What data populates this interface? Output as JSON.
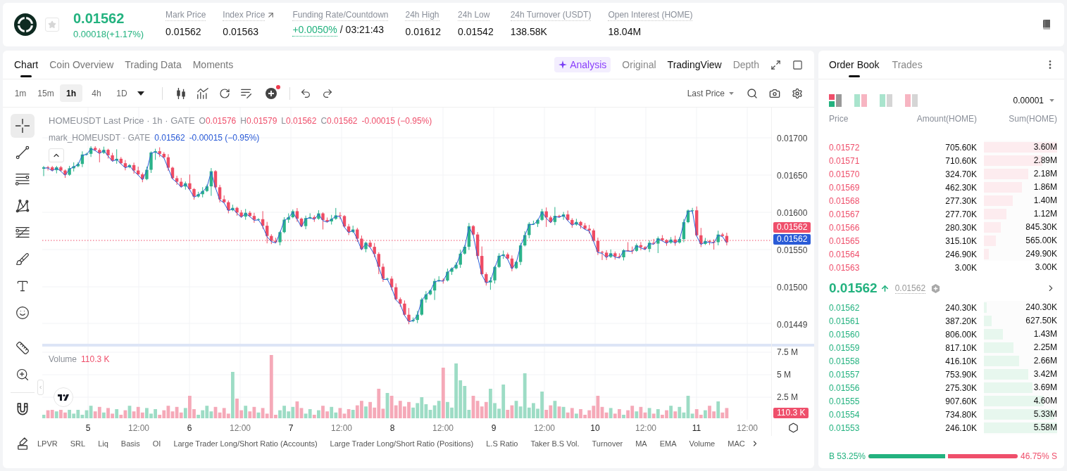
{
  "header": {
    "favorite": false,
    "price": "0.01562",
    "change": "0.00018(+1.17%)",
    "stats": [
      {
        "kind": "plain",
        "label": "Mark Price",
        "value": "0.01562"
      },
      {
        "kind": "link",
        "label": "Index Price",
        "value": "0.01563"
      },
      {
        "kind": "funding",
        "label": "Funding Rate/Countdown",
        "value": "+0.0050%",
        "countdown": "/ 03:21:43"
      },
      {
        "kind": "plain",
        "label": "24h High",
        "value": "0.01612"
      },
      {
        "kind": "plain",
        "label": "24h Low",
        "value": "0.01542"
      },
      {
        "kind": "plain",
        "label": "24h Turnover (USDT)",
        "value": "138.58K"
      },
      {
        "kind": "plain",
        "label": "Open Interest (HOME)",
        "value": "18.04M"
      }
    ]
  },
  "chart_panel": {
    "tabs": [
      {
        "label": "Chart",
        "selected": true
      },
      {
        "label": "Coin Overview",
        "selected": false
      },
      {
        "label": "Trading Data",
        "selected": false
      },
      {
        "label": "Moments",
        "selected": false
      }
    ],
    "views": [
      {
        "kind": "ai",
        "label": "Analysis",
        "selected": false
      },
      {
        "kind": "plain",
        "label": "Original",
        "selected": false
      },
      {
        "kind": "plain",
        "label": "TradingView",
        "selected": true
      },
      {
        "kind": "plain",
        "label": "Depth",
        "selected": false
      }
    ],
    "intervals": [
      {
        "label": "1m",
        "selected": false
      },
      {
        "label": "15m",
        "selected": false
      },
      {
        "label": "1h",
        "selected": true
      },
      {
        "label": "4h",
        "selected": false
      },
      {
        "label": "1D",
        "selected": false
      }
    ],
    "price_source": "Last Price",
    "drawing_tools": [
      {
        "kind": "crosshair",
        "selected": true
      },
      {
        "kind": "trend_line",
        "selected": false
      },
      {
        "kind": "horizontal_lines",
        "selected": false
      },
      {
        "kind": "pattern",
        "selected": false
      },
      {
        "kind": "fib",
        "selected": false
      },
      {
        "kind": "brush",
        "selected": false
      },
      {
        "kind": "text",
        "selected": false
      },
      {
        "kind": "emoji",
        "selected": false
      },
      {
        "kind": "ruler",
        "selected": false
      },
      {
        "kind": "zoom",
        "selected": false
      },
      {
        "kind": "magnet",
        "selected": false
      }
    ],
    "legend": {
      "title": "HOMEUSDT Last Price · 1h · GATE",
      "ohlc": [
        {
          "key": "O",
          "value": "0.01576"
        },
        {
          "key": "H",
          "value": "0.01579"
        },
        {
          "key": "L",
          "value": "0.01562"
        },
        {
          "key": "C",
          "value": "0.01562"
        }
      ],
      "change": "-0.00015 (−0.95%)"
    },
    "mark_legend": {
      "title": "mark_HOMEUSDT · GATE",
      "value": "0.01562",
      "change": "-0.00015 (−0.95%)"
    },
    "price_axis": [
      "0.01700",
      "0.01650",
      "0.01600",
      "0.01550",
      "0.01500",
      "0.01449"
    ],
    "price_tags": [
      {
        "label": "0.01562",
        "color": "#ef4f6b"
      },
      {
        "label": "0.01562",
        "color": "#2a5bd7"
      }
    ],
    "volume": {
      "title": "Volume",
      "value": "110.3 K",
      "axis": [
        "7.5 M",
        "5 M",
        "2.5 M"
      ],
      "tag": "110.3 K"
    },
    "time_axis": [
      {
        "kind": "day",
        "label": "5"
      },
      {
        "kind": "time",
        "label": "12:00"
      },
      {
        "kind": "day",
        "label": "6"
      },
      {
        "kind": "time",
        "label": "12:00"
      },
      {
        "kind": "day",
        "label": "7"
      },
      {
        "kind": "time",
        "label": "12:00"
      },
      {
        "kind": "day",
        "label": "8"
      },
      {
        "kind": "time",
        "label": "12:00"
      },
      {
        "kind": "day",
        "label": "9"
      },
      {
        "kind": "time",
        "label": "12:00"
      },
      {
        "kind": "day",
        "label": "10"
      },
      {
        "kind": "time",
        "label": "12:00"
      },
      {
        "kind": "day",
        "label": "11"
      },
      {
        "kind": "time",
        "label": "12:00"
      }
    ],
    "indicators": [
      "LPVR",
      "SRL",
      "Liq",
      "Basis",
      "OI",
      "Large Trader Long/Short Ratio (Accounts)",
      "Large Trader Long/Short Ratio (Positions)",
      "L.S Ratio",
      "Taker B.S Vol.",
      "Turnover",
      "MA",
      "EMA",
      "Volume",
      "MAC"
    ]
  },
  "order_book": {
    "tabs": [
      {
        "label": "Order Book",
        "selected": true
      },
      {
        "label": "Trades",
        "selected": false
      }
    ],
    "view_modes": [
      {
        "kind": "both",
        "selected": true
      },
      {
        "kind": "split",
        "selected": false
      },
      {
        "kind": "bids",
        "selected": false
      },
      {
        "kind": "asks",
        "selected": false
      }
    ],
    "precision": "0.00001",
    "columns": [
      "Price",
      "Amount(HOME)",
      "Sum(HOME)"
    ],
    "asks": [
      {
        "price": "0.01572",
        "amount": "705.60K",
        "sum": "3.60M",
        "level": 1
      },
      {
        "price": "0.01571",
        "amount": "710.60K",
        "sum": "2.89M",
        "level": 0.8
      },
      {
        "price": "0.01570",
        "amount": "324.70K",
        "sum": "2.18M",
        "level": 0.61
      },
      {
        "price": "0.01569",
        "amount": "462.30K",
        "sum": "1.86M",
        "level": 0.52
      },
      {
        "price": "0.01568",
        "amount": "277.30K",
        "sum": "1.40M",
        "level": 0.39
      },
      {
        "price": "0.01567",
        "amount": "277.70K",
        "sum": "1.12M",
        "level": 0.31
      },
      {
        "price": "0.01566",
        "amount": "280.30K",
        "sum": "845.30K",
        "level": 0.23
      },
      {
        "price": "0.01565",
        "amount": "315.10K",
        "sum": "565.00K",
        "level": 0.16
      },
      {
        "price": "0.01564",
        "amount": "246.90K",
        "sum": "249.90K",
        "level": 0.07
      },
      {
        "price": "0.01563",
        "amount": "3.00K",
        "sum": "3.00K"
      }
    ],
    "last_price": {
      "price": "0.01562",
      "rising": true,
      "mark": "0.01562"
    },
    "bids": [
      {
        "price": "0.01562",
        "amount": "240.30K",
        "sum": "240.30K",
        "level": 0.04
      },
      {
        "price": "0.01561",
        "amount": "387.20K",
        "sum": "627.50K",
        "level": 0.11
      },
      {
        "price": "0.01560",
        "amount": "806.00K",
        "sum": "1.43M",
        "level": 0.26
      },
      {
        "price": "0.01559",
        "amount": "817.10K",
        "sum": "2.25M",
        "level": 0.4
      },
      {
        "price": "0.01558",
        "amount": "416.10K",
        "sum": "2.66M",
        "level": 0.48
      },
      {
        "price": "0.01557",
        "amount": "753.90K",
        "sum": "3.42M",
        "level": 0.61
      },
      {
        "price": "0.01556",
        "amount": "275.30K",
        "sum": "3.69M",
        "level": 0.66
      },
      {
        "price": "0.01555",
        "amount": "907.60K",
        "sum": "4.60M",
        "level": 0.82
      },
      {
        "price": "0.01554",
        "amount": "734.80K",
        "sum": "5.33M",
        "level": 0.96
      },
      {
        "price": "0.01553",
        "amount": "246.10K",
        "sum": "5.58M",
        "level": 1
      }
    ],
    "ratio": {
      "buy": "B 53.25%",
      "sell": "46.75% S",
      "level": 0.5325
    }
  }
}
